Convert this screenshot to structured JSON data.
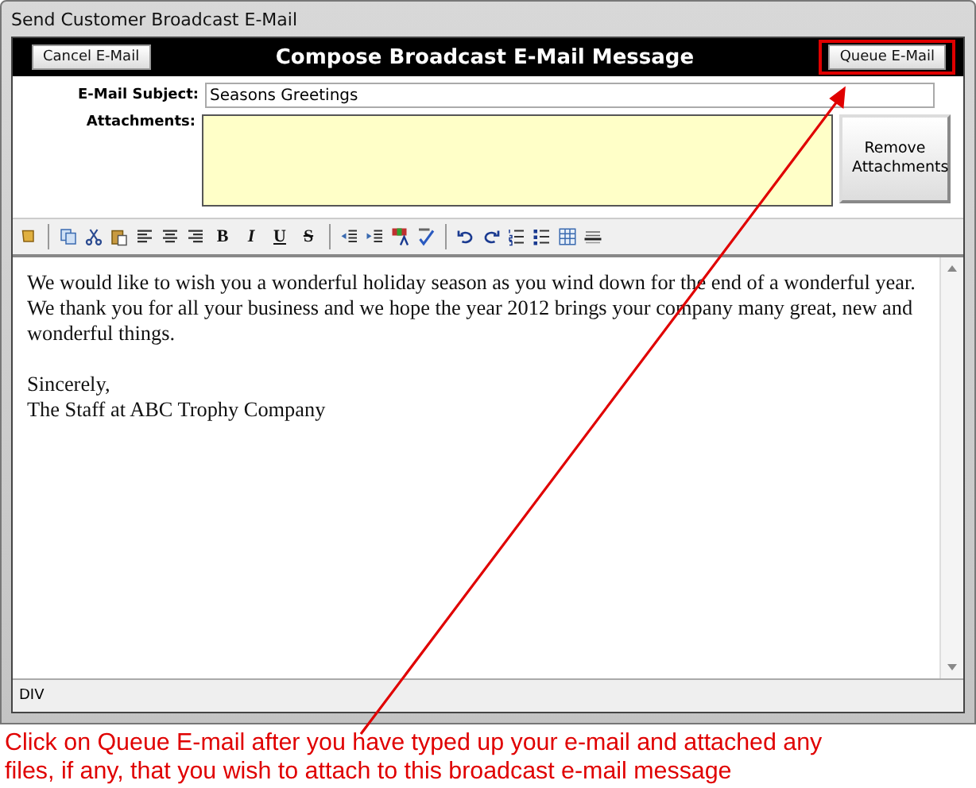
{
  "window": {
    "title": "Send Customer Broadcast E-Mail"
  },
  "header": {
    "title": "Compose Broadcast E-Mail Message",
    "cancel_button": "Cancel E-Mail",
    "queue_button": "Queue E-Mail"
  },
  "form": {
    "subject_label": "E-Mail Subject:",
    "subject_value": "Seasons Greetings",
    "attachments_label": "Attachments:",
    "remove_button": "Remove Attachments"
  },
  "toolbar": {
    "format_buttons": [
      "B",
      "I",
      "U",
      "S"
    ]
  },
  "editor": {
    "paragraphs": [
      [
        "We would like to wish you a wonderful holiday season as you wind down for the end of a wonderful year.  We thank you for all your business and we hope the year 2012 brings your company many great, new and wonderful things."
      ],
      [
        "Sincerely,",
        "The Staff at ABC Trophy Company"
      ]
    ]
  },
  "status_bar": {
    "text": "DIV"
  },
  "annotation": {
    "caption": "Click on Queue E-mail after you have typed up your e-mail and attached any files, if any, that you wish to attach to this broadcast e-mail message"
  }
}
